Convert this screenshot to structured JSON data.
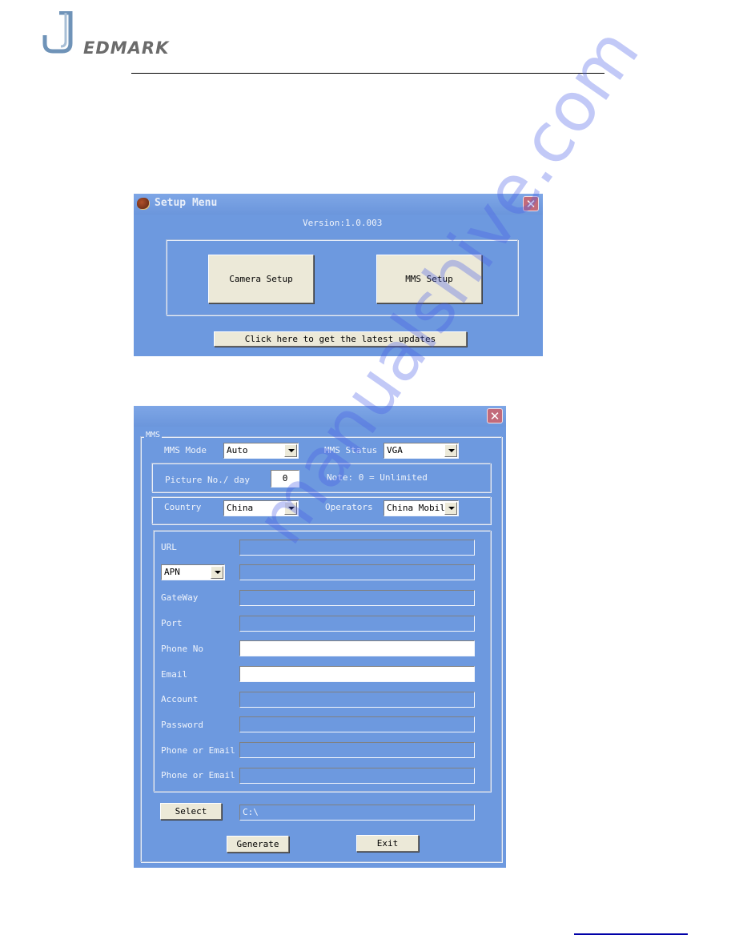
{
  "logo": {
    "letter": "J",
    "text": "EDMARK"
  },
  "setup_menu": {
    "title": "Setup Menu",
    "version": "Version:1.0.003",
    "camera_setup_label": "Camera Setup",
    "mms_setup_label": "MMS Setup",
    "updates_label": "Click here to get the latest updates",
    "close_glyph": "✕"
  },
  "mms_dialog": {
    "close_glyph": "✕",
    "group_title": "MMS",
    "mms_mode": {
      "label": "MMS Mode",
      "value": "Auto"
    },
    "mms_status": {
      "label": "MMS Status",
      "value": "VGA"
    },
    "picture_per_day": {
      "label": "Picture No./ day",
      "value": "0",
      "note": "Note: 0 = Unlimited"
    },
    "country": {
      "label": "Country",
      "value": "China"
    },
    "operators": {
      "label": "Operators",
      "value": "China Mobil"
    },
    "fields": [
      {
        "label": "URL",
        "value": "",
        "editable": false
      },
      {
        "label": "APN",
        "value": "",
        "editable": false,
        "is_combo": true
      },
      {
        "label": "GateWay",
        "value": "",
        "editable": false
      },
      {
        "label": "Port",
        "value": "",
        "editable": false
      },
      {
        "label": "Phone No",
        "value": "",
        "editable": true
      },
      {
        "label": "Email",
        "value": "",
        "editable": true
      },
      {
        "label": "Account",
        "value": "",
        "editable": false
      },
      {
        "label": "Password",
        "value": "",
        "editable": false
      },
      {
        "label": "Phone or Email",
        "value": "",
        "editable": false
      },
      {
        "label": "Phone or Email",
        "value": "",
        "editable": false
      }
    ],
    "select_label": "Select",
    "path_value": "C:\\",
    "generate_label": "Generate",
    "exit_label": "Exit"
  },
  "watermark": "manualshive.com"
}
